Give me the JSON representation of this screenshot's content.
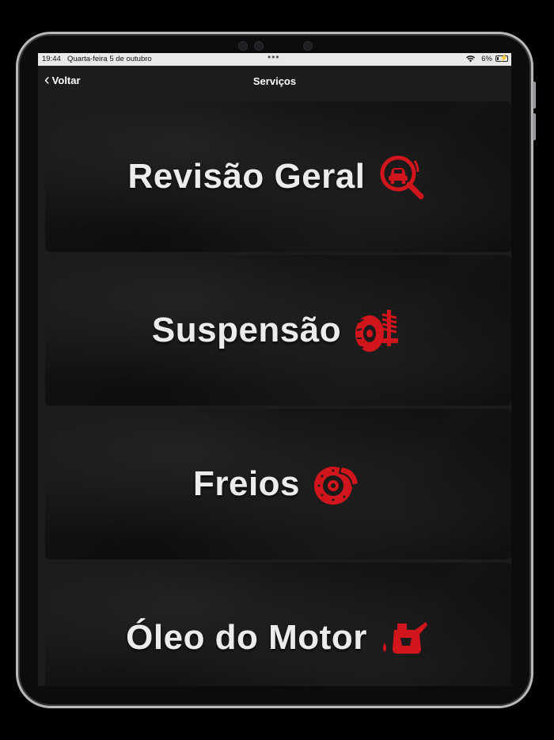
{
  "status_bar": {
    "time": "19:44",
    "date": "Quarta-feira 5 de outubro",
    "battery": "6%"
  },
  "nav": {
    "back_label": "Voltar",
    "title": "Serviços"
  },
  "services": [
    {
      "label": "Revisão Geral",
      "icon": "car-inspection-magnifier-icon"
    },
    {
      "label": "Suspensão",
      "icon": "tire-suspension-icon"
    },
    {
      "label": "Freios",
      "icon": "brake-disc-icon"
    },
    {
      "label": "Óleo do Motor",
      "icon": "oil-can-icon"
    }
  ],
  "colors": {
    "accent": "#d0161c",
    "background": "#1c1c1e",
    "text": "#ececec"
  }
}
